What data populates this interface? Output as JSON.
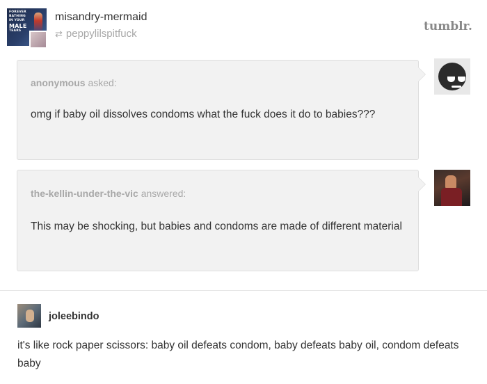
{
  "post": {
    "avatar_text": [
      "FOREVER",
      "BATHING",
      "IN YOUR",
      "MALE",
      "TEARS"
    ],
    "username": "misandry-mermaid",
    "reblogged_from": "peppylilspitfuck",
    "reblog_icon": "reblog-icon",
    "brand": "tumblr."
  },
  "question": {
    "asker": "anonymous",
    "verb": "asked:",
    "text": "omg if baby oil dissolves condoms what the fuck does it do to babies???",
    "avatar_icon": "anonymous-sunglasses-icon"
  },
  "answer": {
    "answerer": "the-kellin-under-the-vic",
    "verb": "answered:",
    "text": "This may be shocking, but babies and condoms are made of different material"
  },
  "reply": {
    "username": "joleebindo",
    "text": "it's like rock paper scissors: baby oil defeats condom, baby defeats baby oil, condom defeats baby"
  },
  "colors": {
    "bubble_bg": "#f2f2f2",
    "muted_text": "#a8a8a8",
    "body_text": "#333333"
  }
}
